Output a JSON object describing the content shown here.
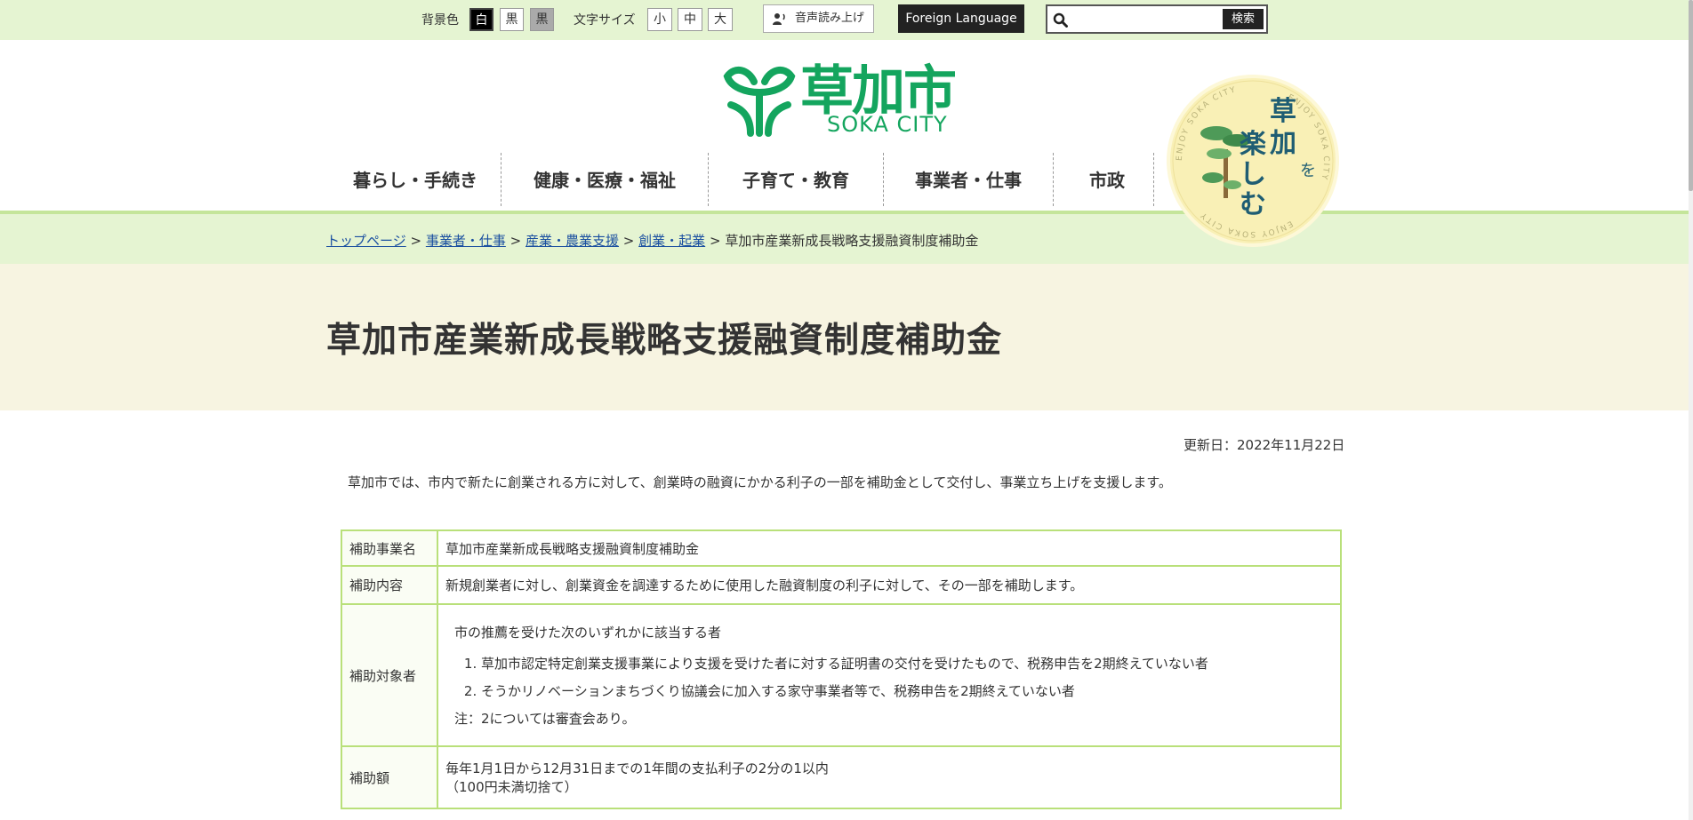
{
  "topbar": {
    "bg_label": "背景色",
    "bg_options": [
      "白",
      "黒",
      "黒"
    ],
    "font_label": "文字サイズ",
    "font_options": [
      "小",
      "中",
      "大"
    ],
    "voice_label": "音声読み上げ",
    "foreign_label": "Foreign Language",
    "search": {
      "placeholder": "",
      "value": "",
      "button_label": "検索"
    },
    "colors": {
      "band": "#e5f4d2"
    }
  },
  "logo": {
    "kanji": "草加市",
    "roman": "SOKA CITY",
    "color": "#14a55e"
  },
  "nav": {
    "items": [
      "暮らし・手続き",
      "健康・医療・福祉",
      "子育て・教育",
      "事業者・仕事",
      "市政"
    ]
  },
  "seal": {
    "title_line1": "草加",
    "title_line2": "楽しむ",
    "particle": "を",
    "ring_text": "ENJOY SOKA CITY"
  },
  "breadcrumb": {
    "links": [
      "トップページ",
      "事業者・仕事",
      "産業・農業支援",
      "創業・起業"
    ],
    "separator": ">",
    "current": "草加市産業新成長戦略支援融資制度補助金"
  },
  "page": {
    "title": "草加市産業新成長戦略支援融資制度補助金",
    "updated": "更新日：2022年11月22日",
    "intro": "草加市では、市内で新たに創業される方に対して、創業時の融資にかかる利子の一部を補助金として交付し、事業立ち上げを支援します。"
  },
  "table": {
    "rows": [
      {
        "label": "補助事業名",
        "value": "草加市産業新成長戦略支援融資制度補助金"
      },
      {
        "label": "補助内容",
        "value": "新規創業者に対し、創業資金を調達するために使用した融資制度の利子に対して、その一部を補助します。"
      },
      {
        "label": "補助対象者",
        "lead": "市の推薦を受けた次のいずれかに該当する者",
        "list": [
          "草加市認定特定創業支援事業により支援を受けた者に対する証明書の交付を受けたもので、税務申告を2期終えていない者",
          "そうかリノベーションまちづくり協議会に加入する家守事業者等で、税務申告を2期終えていない者"
        ],
        "note": "注：2については審査会あり。"
      },
      {
        "label": "補助額",
        "line1": "毎年1月1日から12月31日までの1年間の支払利子の2分の1以内",
        "line2": "（100円未満切捨て）"
      }
    ],
    "border_color": "#b9e07a"
  }
}
